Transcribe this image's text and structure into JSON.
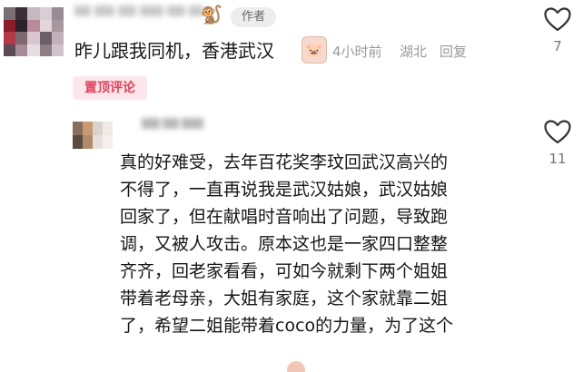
{
  "comment": {
    "author_tag": "作者",
    "emoji": "🐒",
    "text": "昨儿跟我同机，香港武汉",
    "sticker": "🐷",
    "time": "4小时前",
    "location": "湖北",
    "reply_label": "回复",
    "pinned_label": "置顶评论",
    "likes": "7"
  },
  "reply": {
    "likes": "11",
    "lines": [
      "真的好难受，去年百花奖李玟回武汉高兴的",
      "不得了，一直再说我是武汉姑娘，武汉姑娘",
      "回家了，但在献唱时音响出了问题，导致跑",
      "调，又被人攻击。原本这也是一家四口整整",
      "齐齐，回老家看看，可如今就剩下两个姐姐",
      "带着老母亲，大姐有家庭，这个家就靠二姐",
      "了，希望二姐能带着coco的力量，为了这个"
    ]
  },
  "colors": {
    "pinned_bg": "#fce6e9",
    "pinned_text": "#e0415e",
    "meta_text": "#9a9a9a"
  },
  "icons": {
    "like": "heart-outline-icon"
  }
}
